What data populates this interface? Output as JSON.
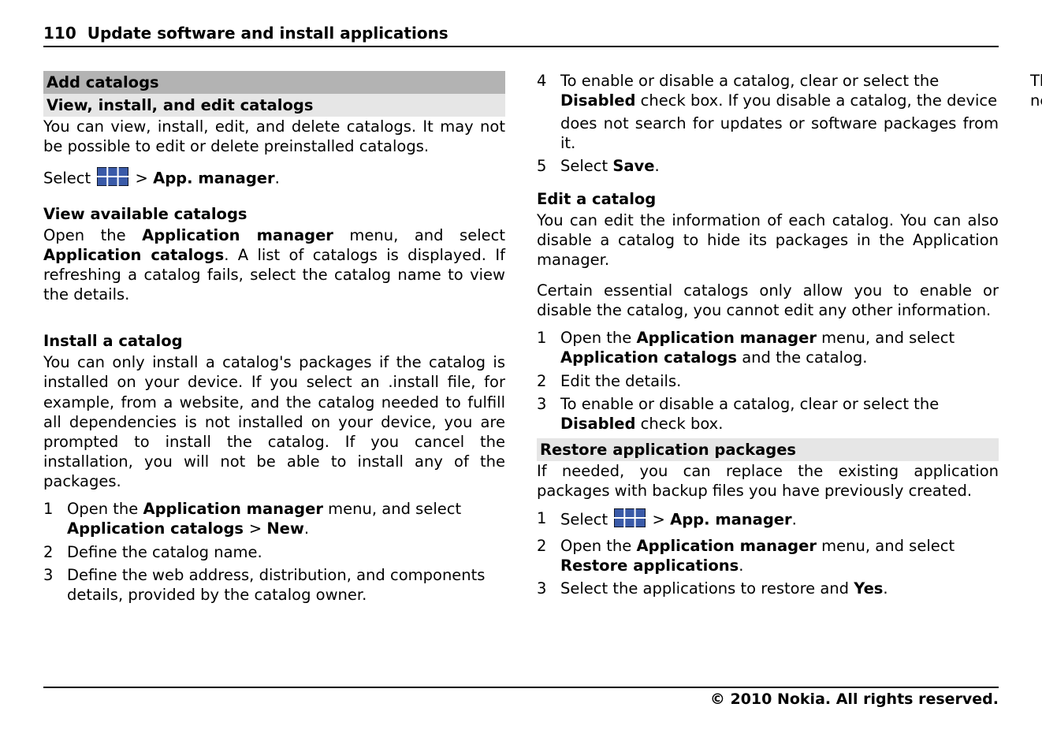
{
  "page": {
    "number": "110",
    "title": "Update software and install applications"
  },
  "sections": {
    "add_catalogs": "Add catalogs",
    "view_install_edit": "View, install, and edit catalogs",
    "restore": "Restore application packages"
  },
  "text": {
    "intro": "You can view, install, edit, and delete catalogs. It may not be possible to edit or delete preinstalled catalogs.",
    "select_prefix": "Select ",
    "select_suffix": " > ",
    "app_manager": "App. manager",
    "period": ".",
    "view_heading": "View available catalogs",
    "view_body_a": "Open the ",
    "view_body_b": "Application manager",
    "view_body_c": " menu, and select ",
    "view_body_d": "Application catalogs",
    "view_body_e": ". A list of catalogs is displayed. If refreshing a catalog fails, select the catalog name to view the details.",
    "install_heading": "Install a catalog",
    "install_body": "You can only install a catalog's packages if the catalog is installed on your device. If you select an .install file, for example, from a website, and the catalog needed to fulfill all dependencies is not installed on your device, you are prompted to install the catalog. If you cancel the installation, you will not be able to install any of the packages.",
    "edit_heading": "Edit a catalog",
    "edit_body1": "You can edit the information of each catalog. You can also disable a catalog to hide its packages in the Application manager.",
    "edit_body2": "Certain essential catalogs only allow you to enable or disable the catalog, you cannot edit any other information.",
    "restore_body": "If needed, you can replace the existing application packages with backup files you have previously created.",
    "restore_tail": "The applications are retrieved from catalogs, using a network connection.",
    "cont_4_tail": "does not search for updates or software packages from it.",
    "step5_a": "Select ",
    "step5_b": "Save",
    "step5_c": "."
  },
  "install_steps": {
    "1a": "Open the ",
    "1b": "Application manager",
    "1c": " menu, and select ",
    "1d": "Application catalogs ",
    "1e": " > ",
    "1f": "New",
    "1g": ".",
    "2": "Define the catalog name.",
    "3": "Define the web address, distribution, and components details, provided by the catalog owner.",
    "4a": "To enable or disable a catalog, clear or select the ",
    "4b": "Disabled",
    "4c": " check box. If you disable a catalog, the device "
  },
  "edit_steps": {
    "1a": "Open the ",
    "1b": "Application manager",
    "1c": " menu, and select ",
    "1d": "Application catalogs",
    "1e": " and the catalog.",
    "2": "Edit the details.",
    "3a": "To enable or disable a catalog, clear or select the ",
    "3b": "Disabled",
    "3c": " check box."
  },
  "restore_steps": {
    "1a": "Select ",
    "1b": " > ",
    "1c": "App. manager",
    "1d": ".",
    "2a": "Open the ",
    "2b": "Application manager",
    "2c": " menu, and select ",
    "2d": "Restore applications",
    "2e": ".",
    "3a": "Select the applications to restore and ",
    "3b": "Yes",
    "3c": "."
  },
  "footer": "© 2010 Nokia. All rights reserved."
}
